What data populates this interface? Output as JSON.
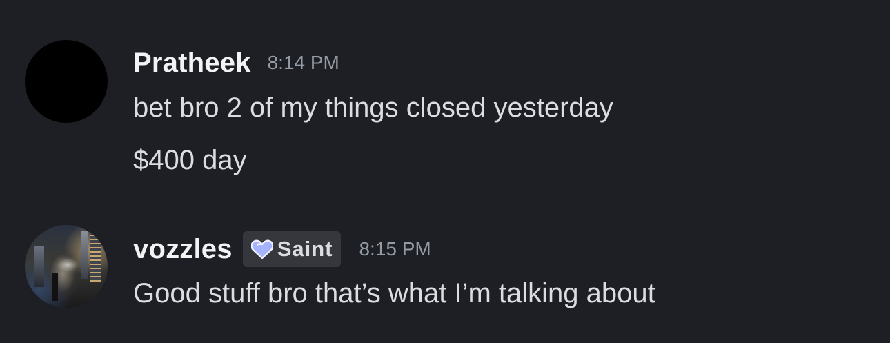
{
  "messages": [
    {
      "author": "Pratheek",
      "timestamp": "8:14 PM",
      "avatar_icon": "black-circle-avatar",
      "lines": [
        "bet bro 2 of my things closed yesterday",
        "$400 day"
      ]
    },
    {
      "author": "vozzles",
      "timestamp": "8:15 PM",
      "avatar_icon": "photo-avatar",
      "role": {
        "icon": "heart-icon",
        "label": "Saint",
        "color": "#a5b3ff"
      },
      "lines": [
        "Good stuff bro that’s what I’m talking about"
      ]
    }
  ],
  "theme": {
    "background": "#1e1f24",
    "text": "#dbdee1",
    "username": "#f2f3f5",
    "timestamp": "#949ba4",
    "role_badge_bg": "#36373d"
  }
}
